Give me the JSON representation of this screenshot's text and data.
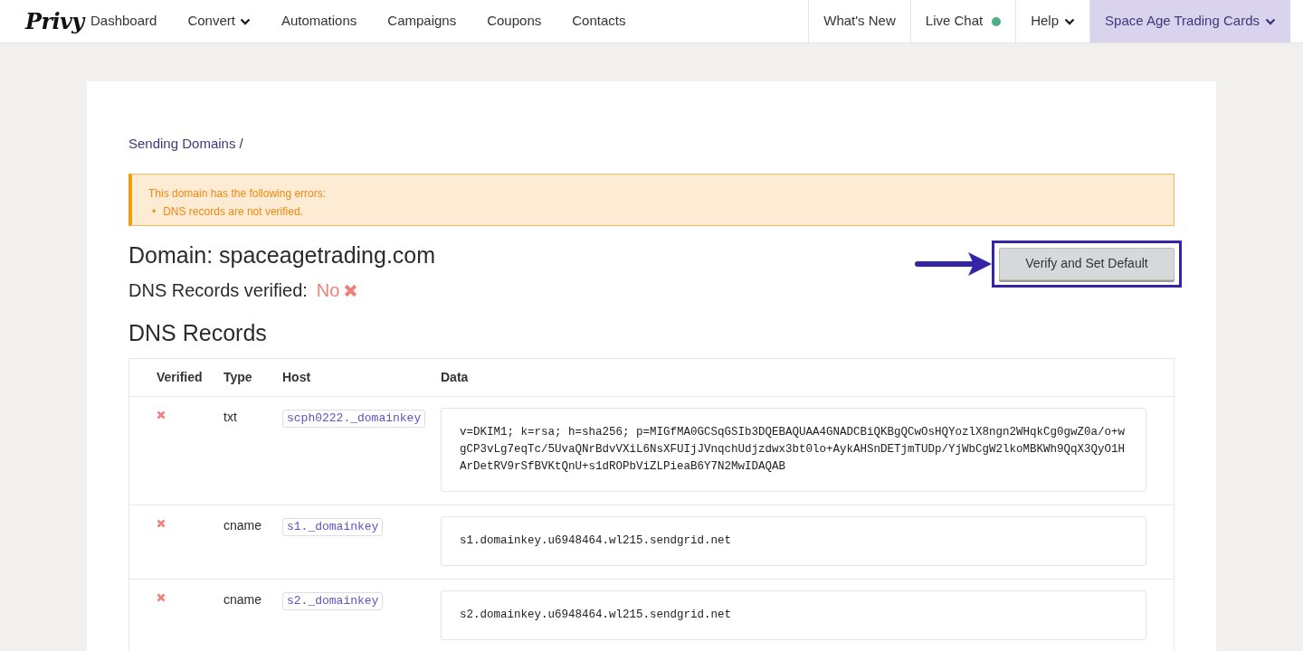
{
  "nav": {
    "logo": "Privy",
    "items": [
      {
        "label": "Dashboard",
        "dropdown": false
      },
      {
        "label": "Convert",
        "dropdown": true
      },
      {
        "label": "Automations",
        "dropdown": false
      },
      {
        "label": "Campaigns",
        "dropdown": false
      },
      {
        "label": "Coupons",
        "dropdown": false
      },
      {
        "label": "Contacts",
        "dropdown": false
      }
    ],
    "right_items": [
      {
        "label": "What's New",
        "kind": "plain"
      },
      {
        "label": "Live Chat",
        "kind": "status",
        "color": "#4caf86"
      },
      {
        "label": "Help",
        "kind": "dropdown"
      },
      {
        "label": "Space Age Trading Cards",
        "kind": "account"
      }
    ]
  },
  "breadcrumb": {
    "link": "Sending Domains",
    "separator": "/"
  },
  "alert": {
    "title": "This domain has the following errors:",
    "bullet": "•",
    "errors": [
      "DNS records are not verified."
    ]
  },
  "domain": {
    "label": "Domain:",
    "value": "spaceagetrading.com"
  },
  "verified_status": {
    "label": "DNS Records verified:",
    "value": "No",
    "verified": false
  },
  "verify_button": {
    "label": "Verify and Set Default"
  },
  "section_title": "DNS Records",
  "table": {
    "columns": [
      "Verified",
      "Type",
      "Host",
      "Data"
    ],
    "rows": [
      {
        "verified": false,
        "type": "txt",
        "host": "scph0222._domainkey",
        "data": "v=DKIM1; k=rsa; h=sha256; p=MIGfMA0GCSqGSIb3DQEBAQUAA4GNADCBiQKBgQCwOsHQYozlX8ngn2WHqkCg0gwZ0a/o+wgCP3vLg7eqTc/5UvaQNrBdvVXiL6NsXFUIjJVnqchUdjzdwx3bt0lo+AykAHSnDETjmTUDp/YjWbCgW2lkoMBKWh9QqX3QyO1HArDetRV9rSfBVKtQnU+s1dROPbViZLPieaB6Y7N2MwIDAQAB"
      },
      {
        "verified": false,
        "type": "cname",
        "host": "s1._domainkey",
        "data": "s1.domainkey.u6948464.wl215.sendgrid.net"
      },
      {
        "verified": false,
        "type": "cname",
        "host": "s2._domainkey",
        "data": "s2.domainkey.u6948464.wl215.sendgrid.net"
      }
    ]
  }
}
